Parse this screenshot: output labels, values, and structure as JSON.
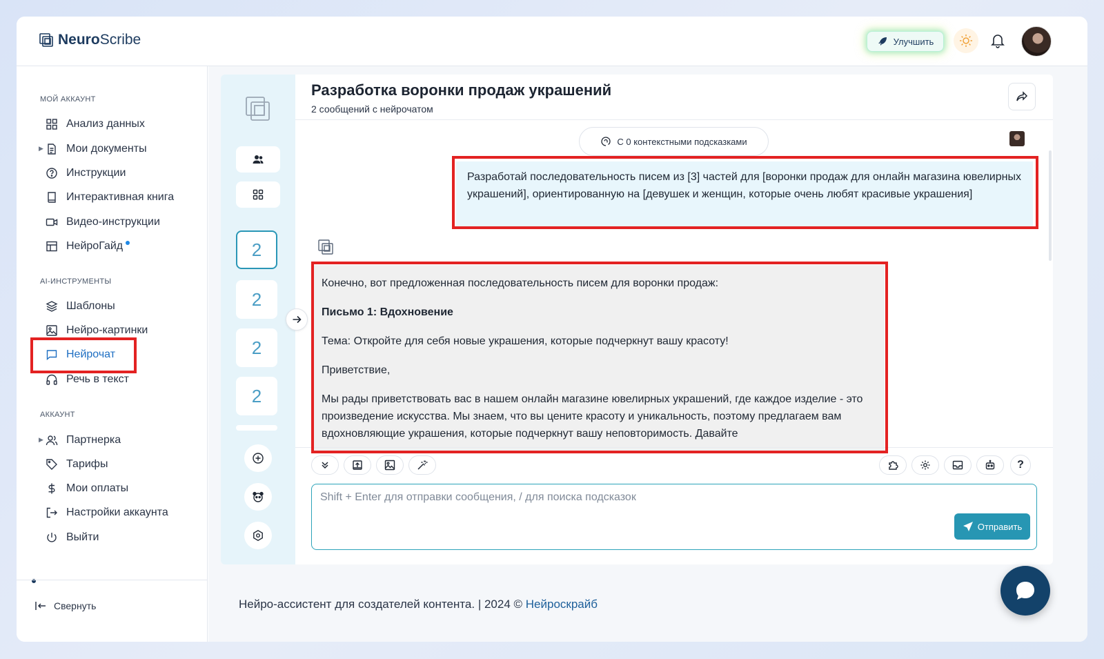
{
  "app": {
    "logo_bold": "Neuro",
    "logo_light": "Scribe"
  },
  "header": {
    "upgrade_label": "Улучшить"
  },
  "sidebar": {
    "sections": [
      {
        "title": "МОЙ АККАУНТ",
        "items": [
          {
            "label": "Анализ данных",
            "icon": "grid-icon"
          },
          {
            "label": "Мои документы",
            "icon": "document-icon"
          },
          {
            "label": "Инструкции",
            "icon": "help-circle-icon"
          },
          {
            "label": "Интерактивная книга",
            "icon": "book-icon"
          },
          {
            "label": "Видео-инструкции",
            "icon": "video-icon"
          },
          {
            "label": "НейроГайд",
            "icon": "table-icon"
          }
        ]
      },
      {
        "title": "AI-ИНСТРУМЕНТЫ",
        "items": [
          {
            "label": "Шаблоны",
            "icon": "layers-icon"
          },
          {
            "label": "Нейро-картинки",
            "icon": "image-icon"
          },
          {
            "label": "Нейрочат",
            "icon": "chat-icon"
          },
          {
            "label": "Речь в текст",
            "icon": "headphones-icon"
          }
        ]
      },
      {
        "title": "АККАУНТ",
        "items": [
          {
            "label": "Партнерка",
            "icon": "users-icon"
          },
          {
            "label": "Тарифы",
            "icon": "tag-icon"
          },
          {
            "label": "Мои оплаты",
            "icon": "dollar-icon"
          },
          {
            "label": "Настройки аккаунта",
            "icon": "logout-arrow-icon"
          },
          {
            "label": "Выйти",
            "icon": "power-icon"
          }
        ]
      }
    ],
    "collapse_label": "Свернуть"
  },
  "threads": {
    "counts": [
      "2",
      "2",
      "2",
      "2"
    ]
  },
  "chat": {
    "title": "Разработка воронки продаж украшений",
    "subtitle": "2 сообщений с нейрочатом",
    "context_label": "С 0 контекстными подсказками",
    "user_message": "Разработай последовательность писем из [3] частей для [воронки продаж для онлайн магазина ювелирных украшений], ориентированную на [девушек и женщин, которые очень любят красивые украшения]",
    "bot_message": {
      "intro": "Конечно, вот предложенная последовательность писем для воронки продаж:",
      "heading": "Письмо 1: Вдохновение",
      "subject": "Тема: Откройте для себя новые украшения, которые подчеркнут вашу красоту!",
      "greeting": "Приветствие,",
      "body": "Мы рады приветствовать вас в нашем онлайн магазине ювелирных украшений, где каждое изделие - это произведение искусства. Мы знаем, что вы цените красоту и уникальность, поэтому предлагаем вам вдохновляющие украшения, которые подчеркнут вашу неповторимость. Давайте"
    },
    "input_placeholder": "Shift + Enter для отправки сообщения, / для поиска подсказок",
    "send_label": "Отправить"
  },
  "footer": {
    "text": "Нейро-ассистент для создателей контента.  | 2024 © ",
    "link": "Нейроскрайб"
  },
  "colors": {
    "accent": "#2796b3",
    "brand_dark": "#13426a",
    "highlight_red": "#e32222"
  }
}
